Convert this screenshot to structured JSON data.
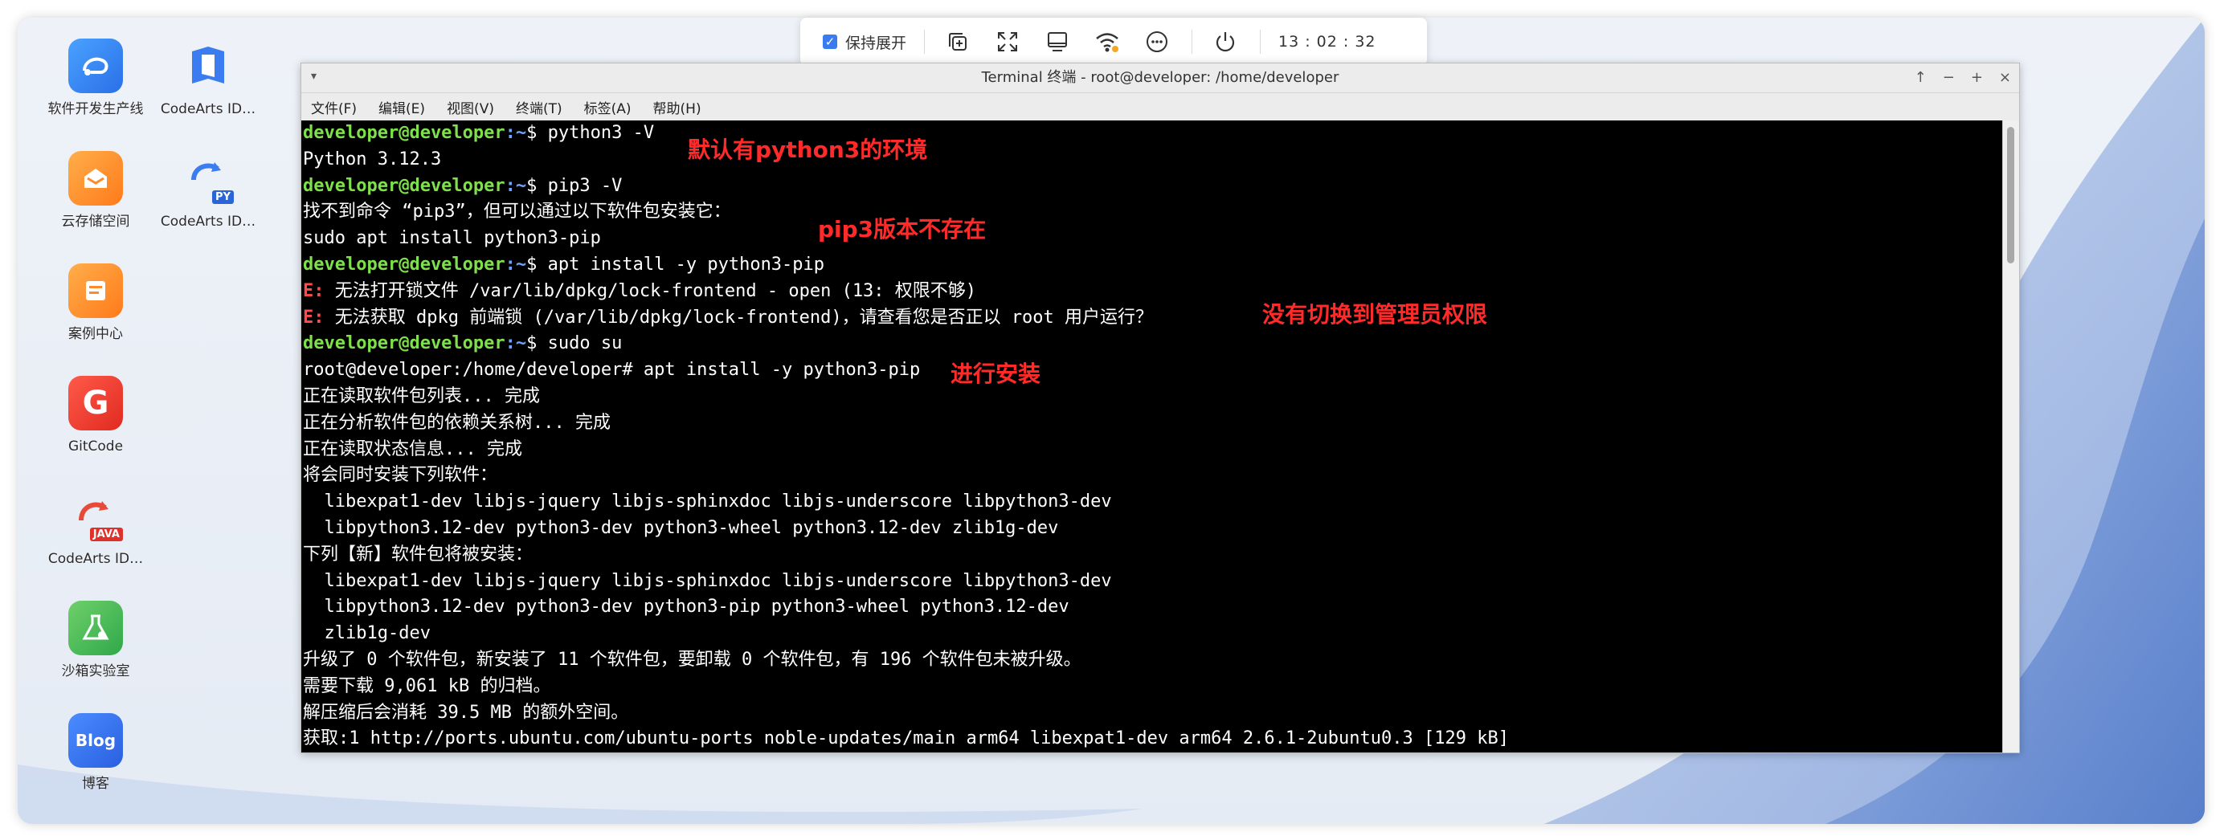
{
  "desktop": {
    "icons": [
      {
        "label": "软件开发生产线",
        "icon": "devops-pipeline-icon"
      },
      {
        "label": "CodeArts ID…",
        "icon": "codearts-ide-icon"
      },
      {
        "label": "云存储空间",
        "icon": "cloud-storage-icon"
      },
      {
        "label": "CodeArts ID…",
        "icon": "codearts-ide-python-icon"
      },
      {
        "label": "案例中心",
        "icon": "case-center-icon"
      },
      {
        "label": "GitCode",
        "icon": "gitcode-icon"
      },
      {
        "label": "CodeArts ID…",
        "icon": "codearts-ide-java-icon"
      },
      {
        "label": "沙箱实验室",
        "icon": "sandbox-lab-icon"
      },
      {
        "label": "博客",
        "icon": "blog-icon"
      }
    ],
    "badges": {
      "py": "PY",
      "java": "JAVA",
      "gitcode": "G",
      "blog": "Blog"
    }
  },
  "topbar": {
    "keep_expanded": "保持展开",
    "clock": "13 : 02 : 32",
    "icons": [
      "copy-icon",
      "fullscreen-icon",
      "screen-icon",
      "wifi-icon",
      "more-icon",
      "power-icon"
    ]
  },
  "window": {
    "title": "Terminal 终端 - root@developer: /home/developer",
    "menu": [
      "文件(F)",
      "编辑(E)",
      "视图(V)",
      "终端(T)",
      "标签(A)",
      "帮助(H)"
    ]
  },
  "terminal": {
    "prompt_user": "developer@developer",
    "prompt_path": ":~",
    "lines": [
      {
        "cmd": "$ python3 -V"
      },
      {
        "text": "Python 3.12.3"
      },
      {
        "cmd": "$ pip3 -V"
      },
      {
        "text": "找不到命令 “pip3”，但可以通过以下软件包安装它："
      },
      {
        "text": "sudo apt install python3-pip"
      },
      {
        "cmd": "$ apt install -y python3-pip"
      },
      {
        "err": "E:",
        "text": " 无法打开锁文件 /var/lib/dpkg/lock-frontend - open (13: 权限不够)"
      },
      {
        "err": "E:",
        "text": " 无法获取 dpkg 前端锁 (/var/lib/dpkg/lock-frontend)，请查看您是否正以 root 用户运行？"
      },
      {
        "cmd": "$ sudo su"
      },
      {
        "text": "root@developer:/home/developer# apt install -y python3-pip"
      },
      {
        "text": "正在读取软件包列表... 完成"
      },
      {
        "text": "正在分析软件包的依赖关系树... 完成"
      },
      {
        "text": "正在读取状态信息... 完成"
      },
      {
        "text": "将会同时安装下列软件："
      },
      {
        "text": "  libexpat1-dev libjs-jquery libjs-sphinxdoc libjs-underscore libpython3-dev"
      },
      {
        "text": "  libpython3.12-dev python3-dev python3-wheel python3.12-dev zlib1g-dev"
      },
      {
        "text": "下列【新】软件包将被安装："
      },
      {
        "text": "  libexpat1-dev libjs-jquery libjs-sphinxdoc libjs-underscore libpython3-dev"
      },
      {
        "text": "  libpython3.12-dev python3-dev python3-pip python3-wheel python3.12-dev"
      },
      {
        "text": "  zlib1g-dev"
      },
      {
        "text": "升级了 0 个软件包，新安装了 11 个软件包，要卸载 0 个软件包，有 196 个软件包未被升级。"
      },
      {
        "text": "需要下载 9,061 kB 的归档。"
      },
      {
        "text": "解压缩后会消耗 39.5 MB 的额外空间。"
      },
      {
        "text": "获取:1 http://ports.ubuntu.com/ubuntu-ports noble-updates/main arm64 libexpat1-dev arm64 2.6.1-2ubuntu0.3 [129 kB]"
      }
    ],
    "annotations": [
      "默认有python3的环境",
      "pip3版本不存在",
      "没有切换到管理员权限",
      "进行安装"
    ]
  }
}
